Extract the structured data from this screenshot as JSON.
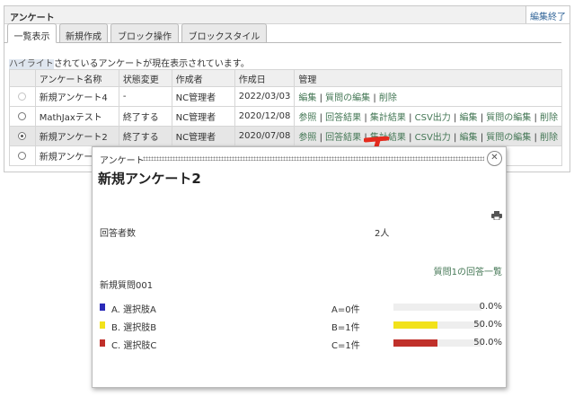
{
  "frame": {
    "title": "アンケート",
    "edit_end": "編集終了"
  },
  "tabs": [
    {
      "label": "一覧表示",
      "active": true
    },
    {
      "label": "新規作成",
      "active": false
    },
    {
      "label": "ブロック操作",
      "active": false
    },
    {
      "label": "ブロックスタイル",
      "active": false
    }
  ],
  "notice": {
    "highlight": "ハイライト",
    "rest": "されているアンケートが現在表示されています。"
  },
  "table": {
    "headers": [
      "",
      "アンケート名称",
      "状態変更",
      "作成者",
      "作成日",
      "管理"
    ],
    "rows": [
      {
        "radio": "disabled",
        "name": "新規アンケート4",
        "status": "-",
        "author": "NC管理者",
        "date": "2022/03/03",
        "manage": [
          "編集",
          "質問の編集",
          "削除"
        ]
      },
      {
        "radio": "off",
        "name": "MathJaxテスト",
        "status": "終了する",
        "author": "NC管理者",
        "date": "2020/12/08",
        "manage": [
          "参照",
          "回答結果",
          "集計結果",
          "CSV出力",
          "編集",
          "質問の編集",
          "削除"
        ]
      },
      {
        "radio": "on",
        "name": "新規アンケート2",
        "status": "終了する",
        "author": "NC管理者",
        "date": "2020/07/08",
        "manage": [
          "参照",
          "回答結果",
          "集計結果",
          "CSV出力",
          "編集",
          "質問の編集",
          "削除"
        ]
      },
      {
        "radio": "off",
        "name": "新規アンケー",
        "status": "",
        "author": "",
        "date": "",
        "manage": []
      }
    ]
  },
  "popup": {
    "label": "アンケート",
    "title": "新規アンケート2",
    "close_icon": "close-icon",
    "print_icon": "printer-icon",
    "respondents_label": "回答者数",
    "respondents_value": "2人",
    "answers_link": "質問1の回答一覧",
    "question": "新規質問001",
    "options": [
      {
        "label": "A.  選択肢A",
        "count": "A=0件",
        "fraction": 0.0,
        "pct": "0.0%",
        "color": "#2a2ab8"
      },
      {
        "label": "B.  選択肢B",
        "count": "B=1件",
        "fraction": 0.5,
        "pct": "50.0%",
        "color": "#f2e21a"
      },
      {
        "label": "C.  選択肢C",
        "count": "C=1件",
        "fraction": 0.5,
        "pct": "50.0%",
        "color": "#c0302a"
      }
    ]
  },
  "annotation": {
    "icon": "arrow-annotation-icon",
    "color": "#e52b1e"
  }
}
